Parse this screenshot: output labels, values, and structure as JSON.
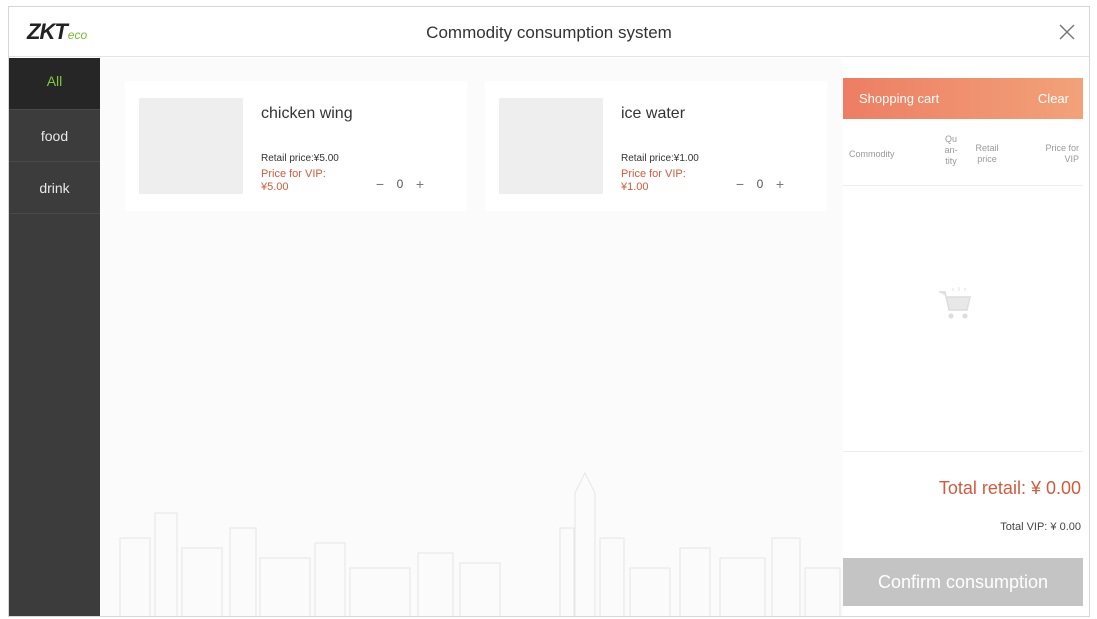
{
  "header": {
    "logo_main": "ZKT",
    "logo_sub": "eco",
    "title": "Commodity consumption system"
  },
  "sidebar": {
    "items": [
      {
        "label": "All",
        "active": true
      },
      {
        "label": "food",
        "active": false
      },
      {
        "label": "drink",
        "active": false
      }
    ]
  },
  "products": [
    {
      "name": "chicken wing",
      "retail": "Retail price:¥5.00",
      "vip_label": "Price for VIP:",
      "vip_value": "¥5.00",
      "qty": "0"
    },
    {
      "name": "ice water",
      "retail": "Retail price:¥1.00",
      "vip_label": "Price for VIP:",
      "vip_value": "¥1.00",
      "qty": "0"
    }
  ],
  "stepper": {
    "minus": "−",
    "plus": "+"
  },
  "cart": {
    "title": "Shopping cart",
    "clear_label": "Clear",
    "columns": {
      "commodity": "Commodity",
      "quantity_1": "Qu",
      "quantity_2": "an-",
      "quantity_3": "tity",
      "retail_1": "Retail",
      "retail_2": "price",
      "vip_1": "Price for",
      "vip_2": "VIP"
    },
    "total_retail": "Total retail: ¥ 0.00",
    "total_vip": "Total VIP: ¥ 0.00",
    "confirm_label": "Confirm consumption"
  },
  "colors": {
    "accent_green": "#7fc93b",
    "cart_header": "#ef8a6b",
    "price_red": "#d35a3c",
    "sidebar_bg": "#3c3c3c"
  },
  "icons": {
    "close": "close-icon",
    "empty_cart": "cart-icon"
  }
}
